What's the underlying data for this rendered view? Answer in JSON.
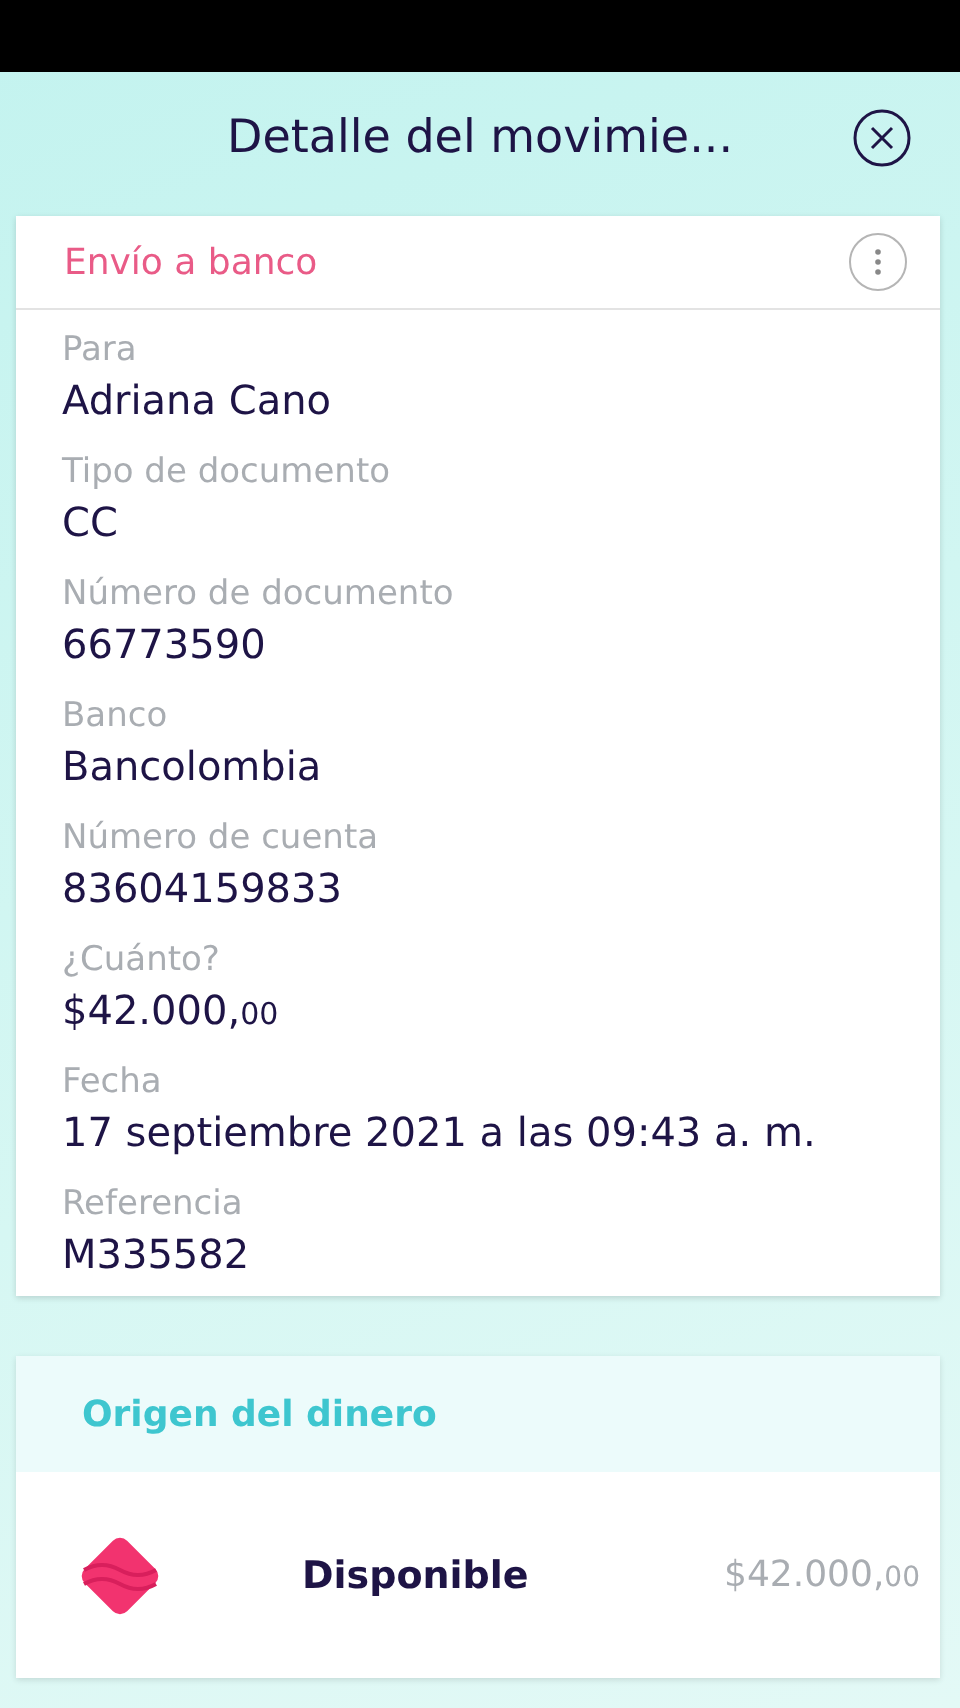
{
  "header": {
    "title": "Detalle del movimie..."
  },
  "detail": {
    "title": "Envío a banco",
    "fields": [
      {
        "label": "Para",
        "value": "Adriana Cano"
      },
      {
        "label": "Tipo de documento",
        "value": "CC"
      },
      {
        "label": "Número de documento",
        "value": "66773590"
      },
      {
        "label": "Banco",
        "value": "Bancolombia"
      },
      {
        "label": "Número de cuenta",
        "value": "83604159833"
      },
      {
        "label": "¿Cuánto?",
        "value": "$42.000,",
        "cents": "00"
      },
      {
        "label": "Fecha",
        "value": "17 septiembre 2021 a las 09:43 a. m."
      },
      {
        "label": "Referencia",
        "value": "M335582"
      }
    ]
  },
  "source": {
    "title": "Origen del dinero",
    "name": "Disponible",
    "amount": "$42.000,",
    "cents": "00"
  }
}
